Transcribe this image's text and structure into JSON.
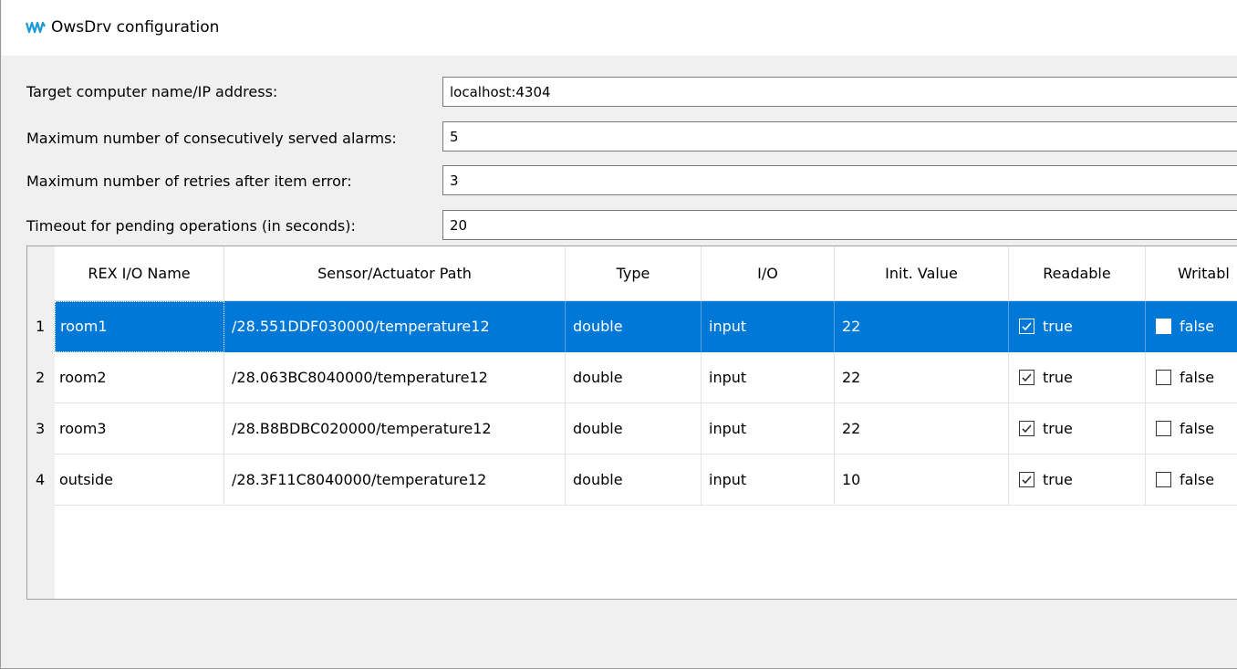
{
  "window": {
    "title": "OwsDrv configuration",
    "logo": "rex-logo-icon"
  },
  "form": {
    "target_label": "Target computer name/IP address:",
    "target_value": "localhost:4304",
    "alarms_label": "Maximum number of consecutively served alarms:",
    "alarms_value": "5",
    "retries_label": "Maximum number of retries after item error:",
    "retries_value": "3",
    "timeout_label": "Timeout for pending operations (in seconds):",
    "timeout_value": "20"
  },
  "table": {
    "headers": [
      "REX I/O Name",
      "Sensor/Actuator Path",
      "Type",
      "I/O",
      "Init. Value",
      "Readable",
      "Writabl"
    ],
    "rows": [
      {
        "num": "1",
        "name": "room1",
        "path": "/28.551DDF030000/temperature12",
        "type": "double",
        "io": "input",
        "init": "22",
        "readable": "true",
        "writable": "false"
      },
      {
        "num": "2",
        "name": "room2",
        "path": "/28.063BC8040000/temperature12",
        "type": "double",
        "io": "input",
        "init": "22",
        "readable": "true",
        "writable": "false"
      },
      {
        "num": "3",
        "name": "room3",
        "path": "/28.B8BDBC020000/temperature12",
        "type": "double",
        "io": "input",
        "init": "22",
        "readable": "true",
        "writable": "false"
      },
      {
        "num": "4",
        "name": "outside",
        "path": "/28.3F11C8040000/temperature12",
        "type": "double",
        "io": "input",
        "init": "10",
        "readable": "true",
        "writable": "false"
      }
    ],
    "selected_row": 1
  },
  "colors": {
    "selection": "#0078d7",
    "window_bg": "#f0f0f0"
  }
}
